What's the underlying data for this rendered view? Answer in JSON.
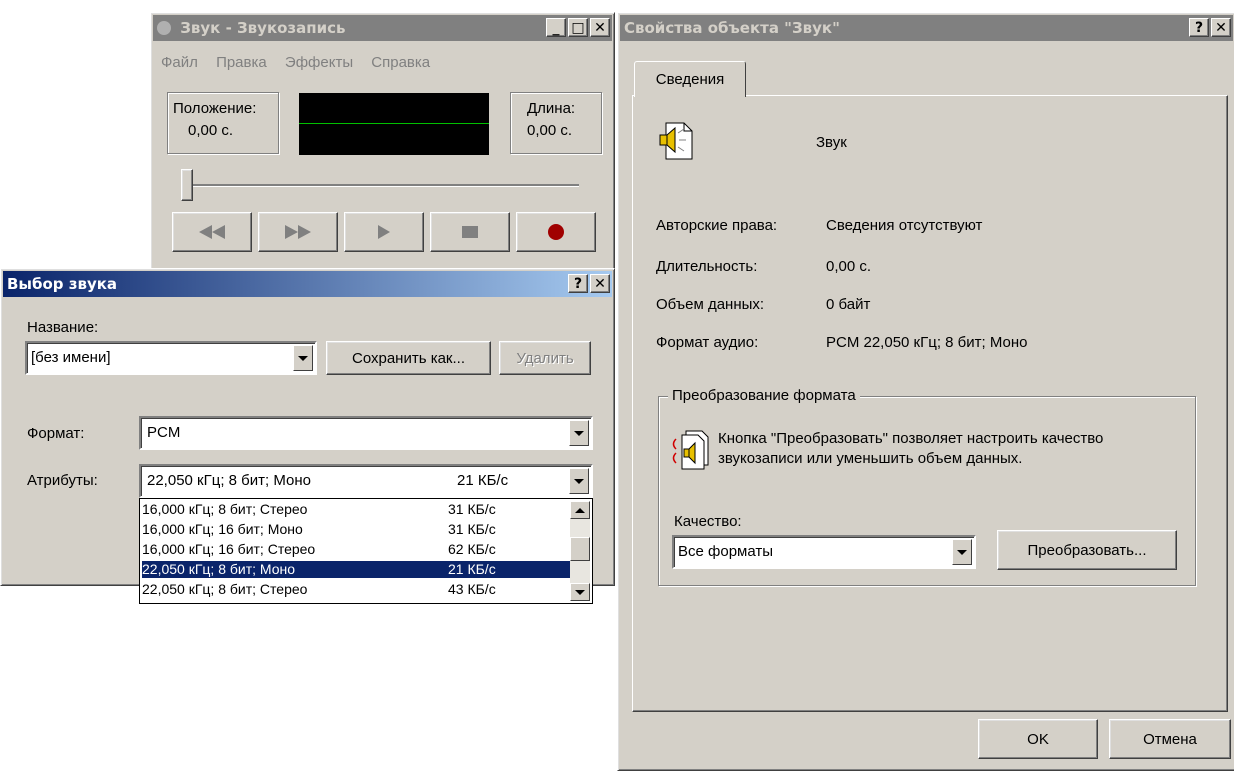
{
  "recorder": {
    "title": "Звук - Звукозапись",
    "menu": [
      "Файл",
      "Правка",
      "Эффекты",
      "Справка"
    ],
    "position_label": "Положение:",
    "position_value": "0,00 с.",
    "length_label": "Длина:",
    "length_value": "0,00 с.",
    "buttons": [
      "rewind",
      "fast-forward",
      "play",
      "stop",
      "record"
    ]
  },
  "sound_select": {
    "title": "Выбор звука",
    "name_label": "Название:",
    "name_value": "[без имени]",
    "save_as_label": "Сохранить как...",
    "delete_label": "Удалить",
    "format_label": "Формат:",
    "format_value": "PCM",
    "attributes_label": "Атрибуты:",
    "attributes_value": "22,050 кГц; 8 бит; Моно",
    "attributes_rate": "21 КБ/с",
    "options": [
      {
        "text": "16,000 кГц; 8 бит; Стерео",
        "rate": "31 КБ/с",
        "selected": false
      },
      {
        "text": "16,000 кГц; 16 бит; Моно",
        "rate": "31 КБ/с",
        "selected": false
      },
      {
        "text": "16,000 кГц; 16 бит; Стерео",
        "rate": "62 КБ/с",
        "selected": false
      },
      {
        "text": "22,050 кГц; 8 бит; Моно",
        "rate": "21 КБ/с",
        "selected": true
      },
      {
        "text": "22,050 кГц; 8 бит; Стерео",
        "rate": "43 КБ/с",
        "selected": false
      }
    ]
  },
  "props": {
    "title": "Свойства объекта \"Звук\"",
    "tab_label": "Сведения",
    "object_name": "Звук",
    "copyright_label": "Авторские права:",
    "copyright_value": "Сведения отсутствуют",
    "duration_label": "Длительность:",
    "duration_value": "0,00 с.",
    "size_label": "Объем данных:",
    "size_value": "0 байт",
    "format_label": "Формат аудио:",
    "format_value": "PCM 22,050 кГц; 8 бит; Моно",
    "group_label": "Преобразование формата",
    "convert_desc": "Кнопка \"Преобразовать\" позволяет настроить качество звукозаписи или уменьшить объем данных.",
    "quality_label": "Качество:",
    "quality_value": "Все форматы",
    "convert_button": "Преобразовать...",
    "ok_label": "OK",
    "cancel_label": "Отмена"
  },
  "titlebar": {
    "help": "?",
    "close": "✕",
    "minimize": "_",
    "maximize": "□"
  },
  "colors": {
    "active_title": "#0a246a",
    "inactive_title": "#808080",
    "face": "#d4d0c8",
    "record": "#a00000",
    "wave": "#00c000"
  }
}
